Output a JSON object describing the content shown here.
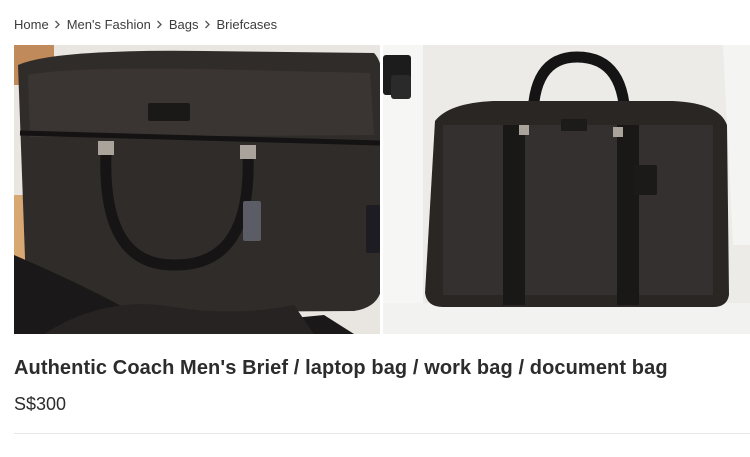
{
  "breadcrumb": {
    "items": [
      "Home",
      "Men's Fashion",
      "Bags",
      "Briefcases"
    ],
    "separator_icon": "chevron-right-icon"
  },
  "gallery": {
    "image_count": 3,
    "active_index": 0,
    "active_dot_color": "#0a9e88"
  },
  "listing": {
    "title": "Authentic Coach Men's Brief / laptop bag / work bag / document bag",
    "price": "S$300"
  }
}
